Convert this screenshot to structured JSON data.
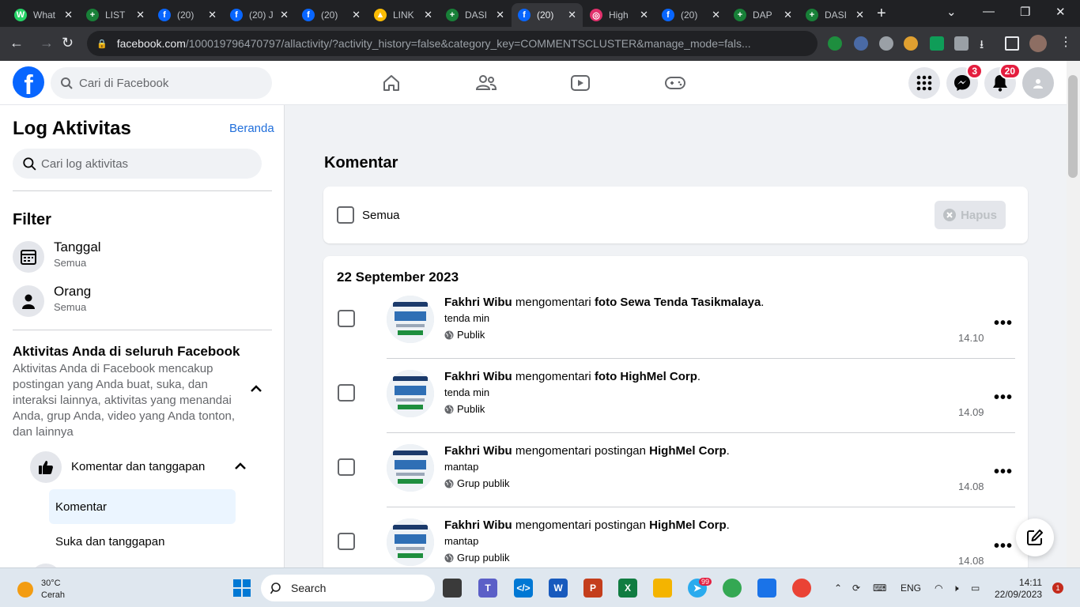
{
  "browser": {
    "tabs": [
      {
        "title": "What",
        "color": "#25d366",
        "glyph": "W"
      },
      {
        "title": "LIST",
        "color": "#188038",
        "glyph": "+"
      },
      {
        "title": "(20)",
        "color": "#0866ff",
        "glyph": "f"
      },
      {
        "title": "(20) J",
        "color": "#0866ff",
        "glyph": "f"
      },
      {
        "title": "(20)",
        "color": "#0866ff",
        "glyph": "f"
      },
      {
        "title": "LINK",
        "color": "#fbbc04",
        "glyph": "▲"
      },
      {
        "title": "DASI",
        "color": "#188038",
        "glyph": "+"
      },
      {
        "title": "(20)",
        "color": "#0866ff",
        "glyph": "f"
      },
      {
        "title": "High",
        "color": "#e1306c",
        "glyph": "◎"
      },
      {
        "title": "(20)",
        "color": "#0866ff",
        "glyph": "f"
      },
      {
        "title": "DAP",
        "color": "#188038",
        "glyph": "+"
      },
      {
        "title": "DASI",
        "color": "#188038",
        "glyph": "+"
      }
    ],
    "active_tab_index": 7,
    "url_host": "facebook.com",
    "url_rest": "/100019796470797/allactivity/?activity_history=false&category_key=COMMENTSCLUSTER&manage_mode=fals..."
  },
  "fb": {
    "search_placeholder": "Cari di Facebook",
    "messenger_badge": "3",
    "notif_badge": "20"
  },
  "sidebar": {
    "title": "Log Aktivitas",
    "home_link": "Beranda",
    "search_placeholder": "Cari log aktivitas",
    "filter_title": "Filter",
    "filters": [
      {
        "label": "Tanggal",
        "sub": "Semua",
        "icon": "calendar-icon"
      },
      {
        "label": "Orang",
        "sub": "Semua",
        "icon": "person-icon"
      }
    ],
    "activity_title": "Aktivitas Anda di seluruh Facebook",
    "activity_desc": "Aktivitas Anda di Facebook mencakup postingan yang Anda buat, suka, dan interaksi lainnya, aktivitas yang menandai Anda, grup Anda, video yang Anda tonton, dan lainnya",
    "category": "Komentar dan tanggapan",
    "sub_items": [
      "Komentar",
      "Suka dan tanggapan"
    ]
  },
  "main": {
    "title": "Komentar",
    "select_all": "Semua",
    "delete_label": "Hapus",
    "date_header": "22 September 2023",
    "activities": [
      {
        "actor": "Fakhri Wibu",
        "verb": "mengomentari",
        "object": "foto Sewa Tenda Tasikmalaya",
        "comment": "tenda min",
        "privacy": "Publik",
        "time": "14.10"
      },
      {
        "actor": "Fakhri Wibu",
        "verb": "mengomentari",
        "object": "foto HighMel Corp",
        "comment": "tenda min",
        "privacy": "Publik",
        "time": "14.09"
      },
      {
        "actor": "Fakhri Wibu",
        "verb": "mengomentari postingan",
        "object": "HighMel Corp",
        "comment": "mantap",
        "privacy": "Grup publik",
        "time": "14.08"
      },
      {
        "actor": "Fakhri Wibu",
        "verb": "mengomentari postingan",
        "object": "HighMel Corp",
        "comment": "mantap",
        "privacy": "Grup publik",
        "time": "14.08"
      }
    ]
  },
  "taskbar": {
    "temp": "30°C",
    "weather": "Cerah",
    "search": "Search",
    "lang": "ENG",
    "time": "14:11",
    "date": "22/09/2023",
    "notif_count": "1",
    "telegram_badge": "99"
  }
}
